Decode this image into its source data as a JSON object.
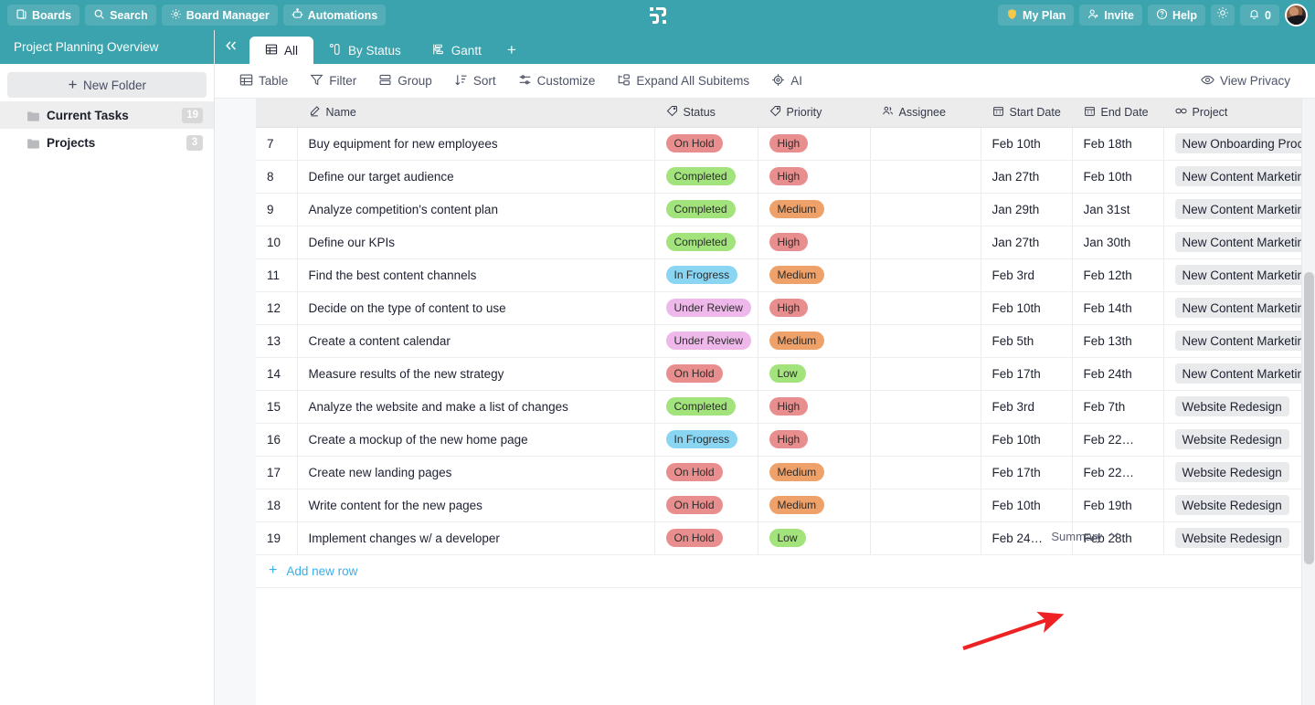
{
  "topbar": {
    "left_buttons": [
      {
        "label": "Boards",
        "icon": "boards-icon"
      },
      {
        "label": "Search",
        "icon": "search-icon"
      },
      {
        "label": "Board Manager",
        "icon": "gear-icon"
      },
      {
        "label": "Automations",
        "icon": "robot-icon"
      }
    ],
    "logo": "app-logo",
    "right_buttons": [
      {
        "label": "My Plan",
        "icon": "shield-icon"
      },
      {
        "label": "Invite",
        "icon": "person-add-icon"
      },
      {
        "label": "Help",
        "icon": "question-circle-icon"
      }
    ],
    "theme_toggle_icon": "sun-icon",
    "notifications": {
      "icon": "bell-icon",
      "count": "0"
    },
    "avatar": "user-avatar"
  },
  "sidebar": {
    "title": "Project Planning Overview",
    "new_folder_label": "New Folder",
    "new_folder_icon": "plus-icon",
    "folders": [
      {
        "name": "Current Tasks",
        "count": "19",
        "active": true
      },
      {
        "name": "Projects",
        "count": "3",
        "active": false
      }
    ]
  },
  "tabs": {
    "collapse_icon": "chevrons-left-icon",
    "items": [
      {
        "label": "All",
        "icon": "table-icon",
        "active": true
      },
      {
        "label": "By Status",
        "icon": "status-icon",
        "active": false
      },
      {
        "label": "Gantt",
        "icon": "gantt-icon",
        "active": false
      }
    ],
    "add_label": "+"
  },
  "toolbar": {
    "items": [
      {
        "label": "Table",
        "icon": "table-icon"
      },
      {
        "label": "Filter",
        "icon": "filter-icon"
      },
      {
        "label": "Group",
        "icon": "group-icon"
      },
      {
        "label": "Sort",
        "icon": "sort-icon"
      },
      {
        "label": "Customize",
        "icon": "sliders-icon"
      },
      {
        "label": "Expand All Subitems",
        "icon": "expand-icon"
      },
      {
        "label": "AI",
        "icon": "ai-icon"
      }
    ],
    "view_privacy_label": "View Privacy",
    "view_privacy_icon": "eye-icon"
  },
  "table": {
    "columns": [
      {
        "key": "idx",
        "label": "",
        "icon": ""
      },
      {
        "key": "name",
        "label": "Name",
        "icon": "pencil-icon"
      },
      {
        "key": "status",
        "label": "Status",
        "icon": "tag-icon"
      },
      {
        "key": "priority",
        "label": "Priority",
        "icon": "tag-icon"
      },
      {
        "key": "assignee",
        "label": "Assignee",
        "icon": "people-icon"
      },
      {
        "key": "start",
        "label": "Start Date",
        "icon": "calendar-icon"
      },
      {
        "key": "end",
        "label": "End Date",
        "icon": "calendar-icon"
      },
      {
        "key": "project",
        "label": "Project",
        "icon": "link-icon"
      }
    ],
    "rows": [
      {
        "idx": "7",
        "name": "Buy equipment for new employees",
        "status": "On Hold",
        "priority": "High",
        "assignee": "user-avatar",
        "start": "Feb 10th",
        "end": "Feb 18th",
        "project": "New Onboarding Process"
      },
      {
        "idx": "8",
        "name": "Define our target audience",
        "status": "Completed",
        "priority": "High",
        "assignee": "user-avatar",
        "start": "Jan 27th",
        "end": "Feb 10th",
        "project": "New Content Marketing St"
      },
      {
        "idx": "9",
        "name": "Analyze competition's content plan",
        "status": "Completed",
        "priority": "Medium",
        "assignee": "user-avatar",
        "start": "Jan 29th",
        "end": "Jan 31st",
        "project": "New Content Marketing St"
      },
      {
        "idx": "10",
        "name": "Define our KPIs",
        "status": "Completed",
        "priority": "High",
        "assignee": "user-avatar",
        "start": "Jan 27th",
        "end": "Jan 30th",
        "project": "New Content Marketing St"
      },
      {
        "idx": "11",
        "name": "Find the best content channels",
        "status": "In Frogress",
        "priority": "Medium",
        "assignee": "user-avatar",
        "start": "Feb 3rd",
        "end": "Feb 12th",
        "project": "New Content Marketing St"
      },
      {
        "idx": "12",
        "name": "Decide on the type of content to use",
        "status": "Under Review",
        "priority": "High",
        "assignee": "user-avatar",
        "start": "Feb 10th",
        "end": "Feb 14th",
        "project": "New Content Marketing St"
      },
      {
        "idx": "13",
        "name": "Create a content calendar",
        "status": "Under Review",
        "priority": "Medium",
        "assignee": "user-avatar",
        "start": "Feb 5th",
        "end": "Feb 13th",
        "project": "New Content Marketing St"
      },
      {
        "idx": "14",
        "name": "Measure results of the new strategy",
        "status": "On Hold",
        "priority": "Low",
        "assignee": "user-avatar",
        "start": "Feb 17th",
        "end": "Feb 24th",
        "project": "New Content Marketing St"
      },
      {
        "idx": "15",
        "name": "Analyze the website and make a list of changes",
        "status": "Completed",
        "priority": "High",
        "assignee": "user-avatar",
        "start": "Feb 3rd",
        "end": "Feb 7th",
        "project": "Website Redesign"
      },
      {
        "idx": "16",
        "name": "Create a mockup of the new home page",
        "status": "In Frogress",
        "priority": "High",
        "assignee": "user-avatar",
        "start": "Feb 10th",
        "end": "Feb 22…",
        "project": "Website Redesign"
      },
      {
        "idx": "17",
        "name": "Create new landing pages",
        "status": "On Hold",
        "priority": "Medium",
        "assignee": "user-avatar",
        "start": "Feb 17th",
        "end": "Feb 22…",
        "project": "Website Redesign"
      },
      {
        "idx": "18",
        "name": "Write content for the new pages",
        "status": "On Hold",
        "priority": "Medium",
        "assignee": "user-avatar",
        "start": "Feb 10th",
        "end": "Feb 19th",
        "project": "Website Redesign"
      },
      {
        "idx": "19",
        "name": "Implement changes w/ a developer",
        "status": "On Hold",
        "priority": "Low",
        "assignee": "user-avatar",
        "start": "Feb 24…",
        "end": "Feb 28th",
        "project": "Website Redesign"
      }
    ],
    "add_row_label": "Add new row",
    "add_row_icon": "plus-icon",
    "summary_label": "Summary",
    "summary_icon": "chevron-down-icon"
  },
  "colors": {
    "brand_teal": "#3aa3ad",
    "status_on_hold": "#e98e8e",
    "status_completed": "#a2e37c",
    "status_in_progress": "#8ad5f2",
    "status_under_review": "#eeb9ea",
    "priority_high": "#e98e8e",
    "priority_medium": "#eea169",
    "priority_low": "#a2e37c",
    "link_blue": "#3aafe8",
    "annotation_red": "#ee2222"
  }
}
